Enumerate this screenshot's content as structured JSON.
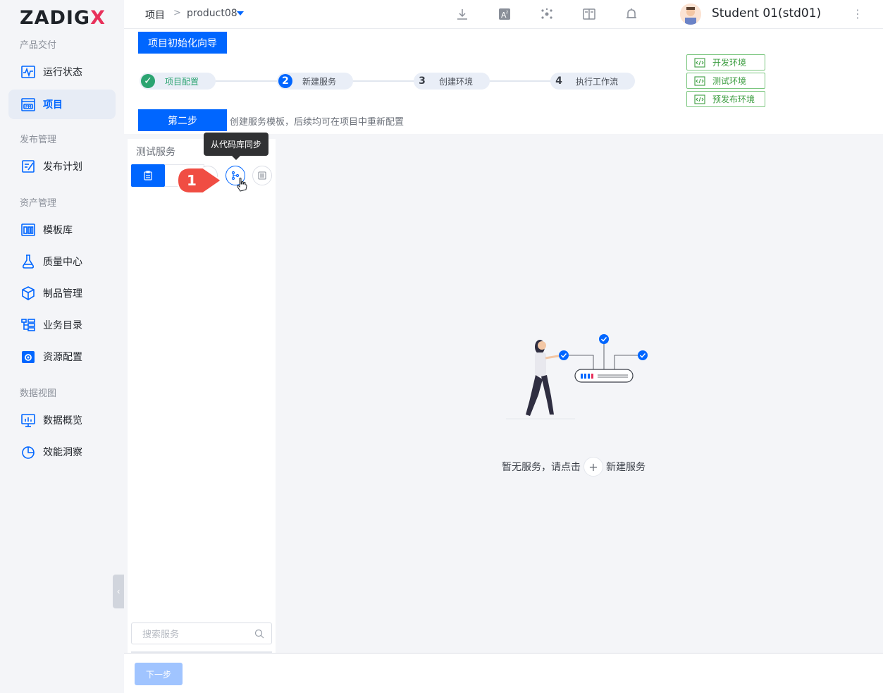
{
  "app": {
    "logo_main": "ZADIG",
    "logo_accent": "X"
  },
  "sidebar": {
    "groups": [
      {
        "label": "产品交付"
      },
      {
        "label": "发布管理"
      },
      {
        "label": "资产管理"
      },
      {
        "label": "数据视图"
      }
    ],
    "items": [
      {
        "label": "运行状态",
        "icon": "pulse-monitor-icon"
      },
      {
        "label": "项目",
        "icon": "pm-project-icon",
        "active": true
      },
      {
        "label": "发布计划",
        "icon": "edit-plan-icon"
      },
      {
        "label": "模板库",
        "icon": "template-grid-icon"
      },
      {
        "label": "质量中心",
        "icon": "flask-icon"
      },
      {
        "label": "制品管理",
        "icon": "package-box-icon"
      },
      {
        "label": "业务目录",
        "icon": "directory-tree-icon"
      },
      {
        "label": "资源配置",
        "icon": "gear-box-icon"
      },
      {
        "label": "数据概览",
        "icon": "dashboard-chart-icon"
      },
      {
        "label": "效能洞察",
        "icon": "pie-chart-icon"
      }
    ]
  },
  "header": {
    "breadcrumb_root": "项目",
    "breadcrumb_sep": ">",
    "project": "product08",
    "user_name": "Student 01(std01)",
    "kebab": "⋮"
  },
  "wizard": {
    "title_button": "项目初始化向导",
    "steps": [
      {
        "num": "✓",
        "label": "项目配置",
        "state": "done"
      },
      {
        "num": "2",
        "label": "新建服务",
        "state": "active"
      },
      {
        "num": "3",
        "label": "创建环境",
        "state": "todo"
      },
      {
        "num": "4",
        "label": "执行工作流",
        "state": "todo"
      }
    ],
    "envs": [
      {
        "label": "开发环境"
      },
      {
        "label": "测试环境"
      },
      {
        "label": "预发布环境"
      }
    ],
    "step_label": "第二步",
    "step_desc": "创建服务模板，后续均可在项目中重新配置"
  },
  "service_panel": {
    "title": "测试服务",
    "tooltip": "从代码库同步",
    "search_placeholder": "搜索服务"
  },
  "callout": {
    "number": "1"
  },
  "empty_state": {
    "text_before": "暂无服务，请点击",
    "plus": "+",
    "text_after": "新建服务"
  },
  "footer": {
    "next_button": "下一步"
  },
  "colors": {
    "primary": "#0066ff",
    "success": "#2ba471",
    "env_tag": "#3c9d40",
    "callout": "#f04d43",
    "logo_accent": "#e8315b"
  }
}
